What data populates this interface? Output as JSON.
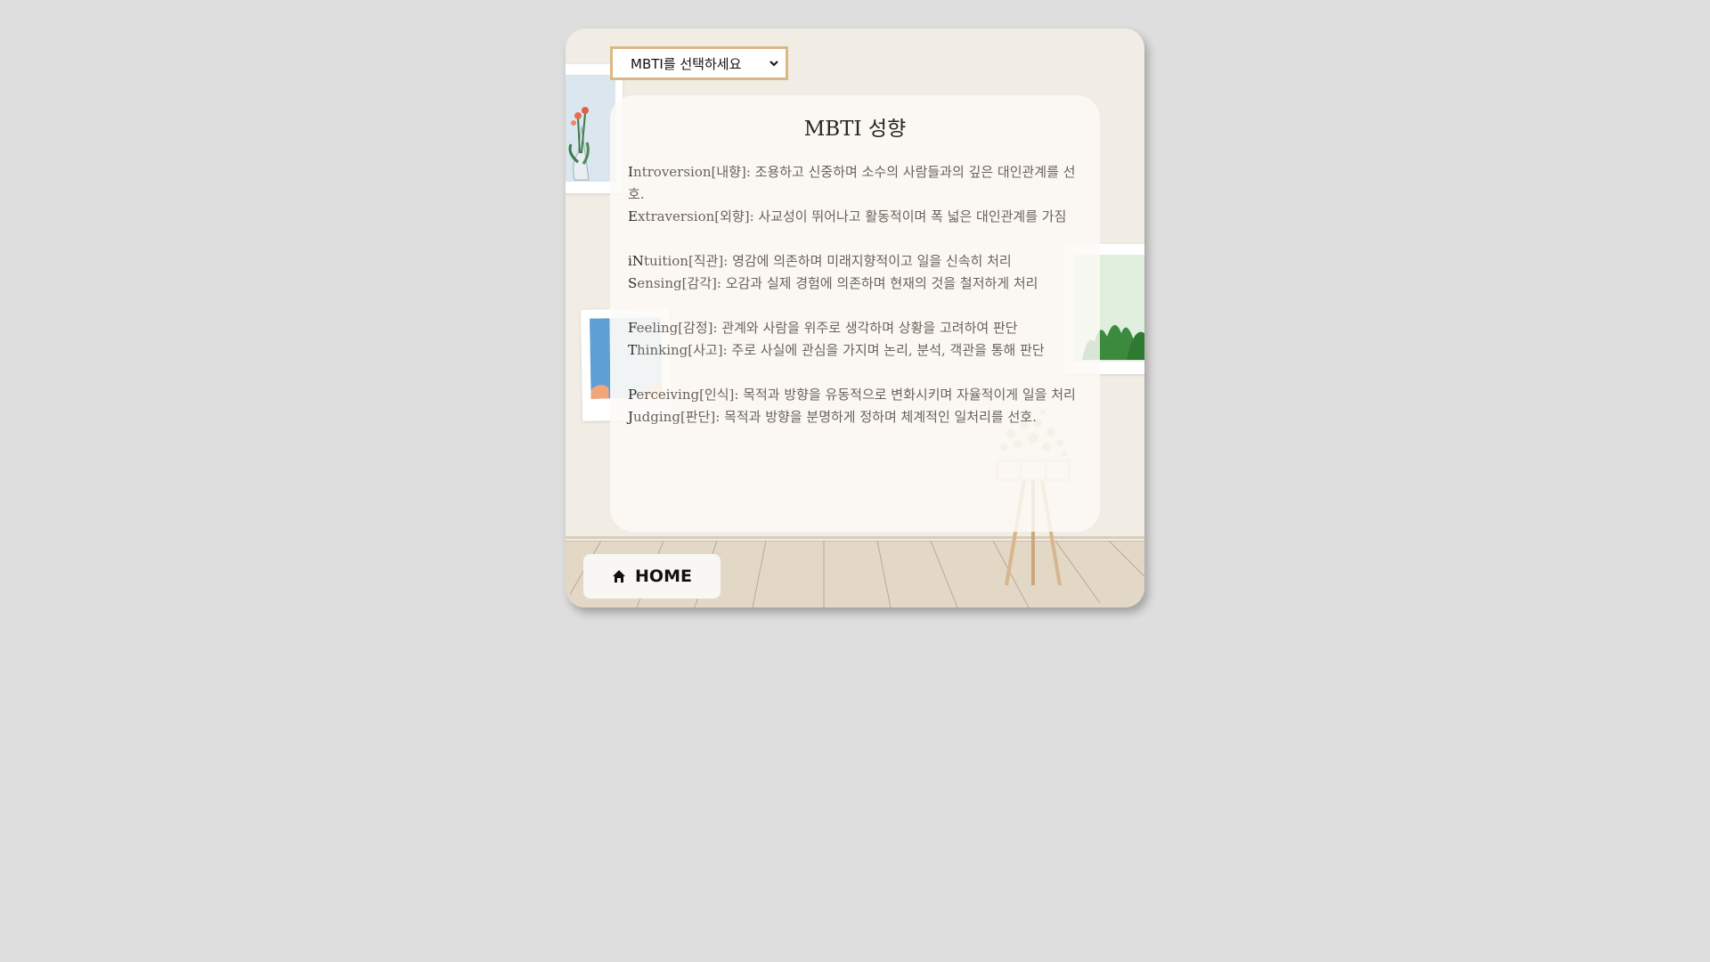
{
  "select": {
    "label": "MBTI를 선택하세요",
    "icon": "chevron-down-icon"
  },
  "panel": {
    "title": "MBTI 성향",
    "groups": [
      [
        {
          "letter": "I",
          "rest": "ntroversion[내향]: 조용하고 신중하며 소수의 사람들과의 깊은 대인관계를 선호."
        },
        {
          "letter": "E",
          "rest": "xtraversion[외향]: 사교성이 뛰어나고 활동적이며 폭 넓은 대인관계를 가짐"
        }
      ],
      [
        {
          "letter": "iN",
          "rest": "tuition[직관]: 영감에 의존하며 미래지향적이고 일을 신속히 처리"
        },
        {
          "letter": "S",
          "rest": "ensing[감각]: 오감과 실제 경험에 의존하며 현재의 것을 철저하게 처리"
        }
      ],
      [
        {
          "letter": "F",
          "rest": "eeling[감정]: 관계와 사람을 위주로 생각하며 상황을 고려하여 판단"
        },
        {
          "letter": "T",
          "rest": "hinking[사고]: 주로 사실에 관심을 가지며 논리, 분석, 객관을 통해 판단"
        }
      ],
      [
        {
          "letter": "P",
          "rest": "erceiving[인식]: 목적과 방향을 유동적으로 변화시키며 자율적이게 일을 처리"
        },
        {
          "letter": "J",
          "rest": "udging[판단]: 목적과 방향을 분명하게 정하며 체계적인 일처리를 선호."
        }
      ]
    ]
  },
  "home_button": {
    "label": "HOME",
    "icon": "home-icon"
  },
  "colors": {
    "page_background": "#dedede",
    "card_background": "#f1ece4",
    "select_border": "#dcb786",
    "floor": "#e3d8c6"
  }
}
